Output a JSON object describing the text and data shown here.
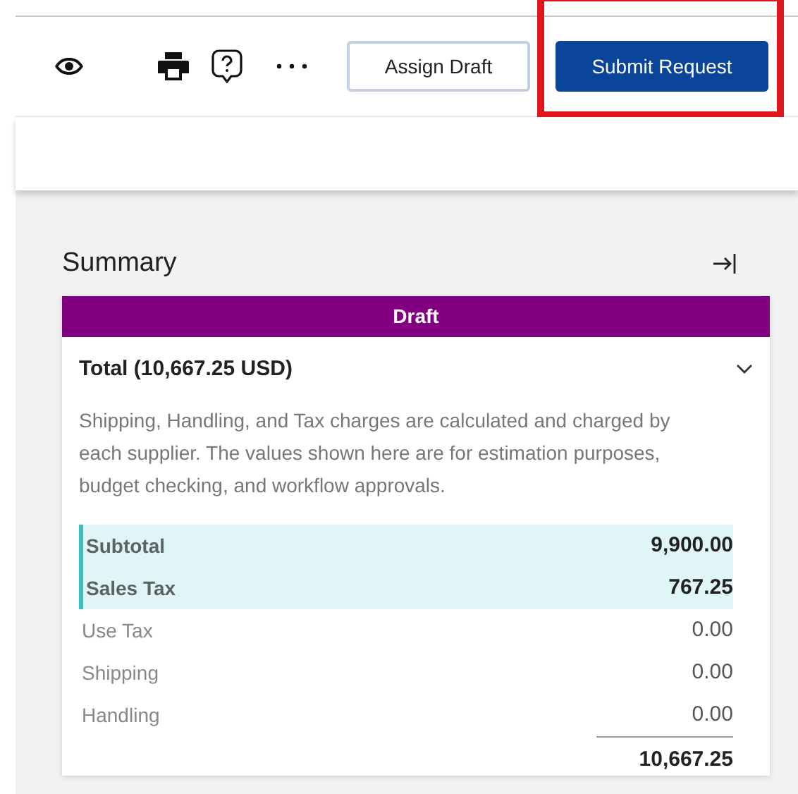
{
  "toolbar": {
    "icons": [
      {
        "kind": "eye"
      },
      {
        "kind": "printer"
      },
      {
        "kind": "help"
      },
      {
        "kind": "more"
      }
    ],
    "buttons": [
      {
        "label": "Assign Draft",
        "kind": "secondary",
        "highlighted": false
      },
      {
        "label": "Submit Request",
        "kind": "primary",
        "highlighted": true
      }
    ]
  },
  "summary": {
    "title": "Summary",
    "status": "Draft",
    "total": "Total (10,667.25 USD)",
    "expanded": true,
    "note": "Shipping, Handling, and Tax charges are calculated and charged by each supplier. The values shown here are for estimation purposes, budget checking, and workflow approvals.",
    "rows": [
      {
        "label": "Subtotal",
        "value": "9,900.00",
        "highlighted": true
      },
      {
        "label": "Sales Tax",
        "value": "767.25",
        "highlighted": true
      },
      {
        "label": "Use Tax",
        "value": "0.00",
        "highlighted": false
      },
      {
        "label": "Shipping",
        "value": "0.00",
        "highlighted": false
      },
      {
        "label": "Handling",
        "value": "0.00",
        "highlighted": false
      }
    ],
    "grand_total": "10,667.25"
  }
}
